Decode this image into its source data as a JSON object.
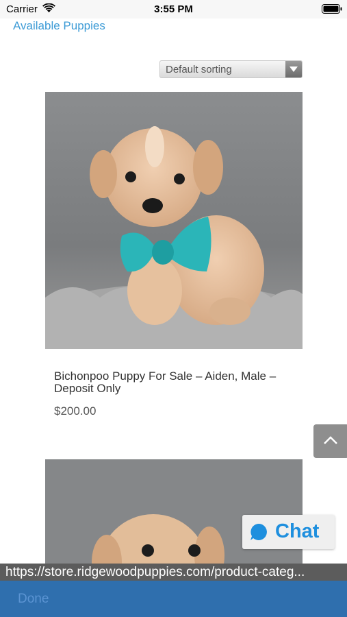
{
  "status_bar": {
    "carrier": "Carrier",
    "time": "3:55 PM"
  },
  "breadcrumb": {
    "link_text": "Available Puppies"
  },
  "sorting": {
    "selected": "Default sorting"
  },
  "products": [
    {
      "title": "Bichonpoo Puppy For Sale – Aiden, Male – Deposit Only",
      "price": "$200.00"
    }
  ],
  "chat": {
    "label": "Chat"
  },
  "browser": {
    "url": "https://store.ridgewoodpuppies.com/product-categ...",
    "done_label": "Done"
  },
  "colors": {
    "link": "#3d9bd6",
    "chat_accent": "#1e8fde",
    "bottom_bar": "#2f6fae"
  }
}
